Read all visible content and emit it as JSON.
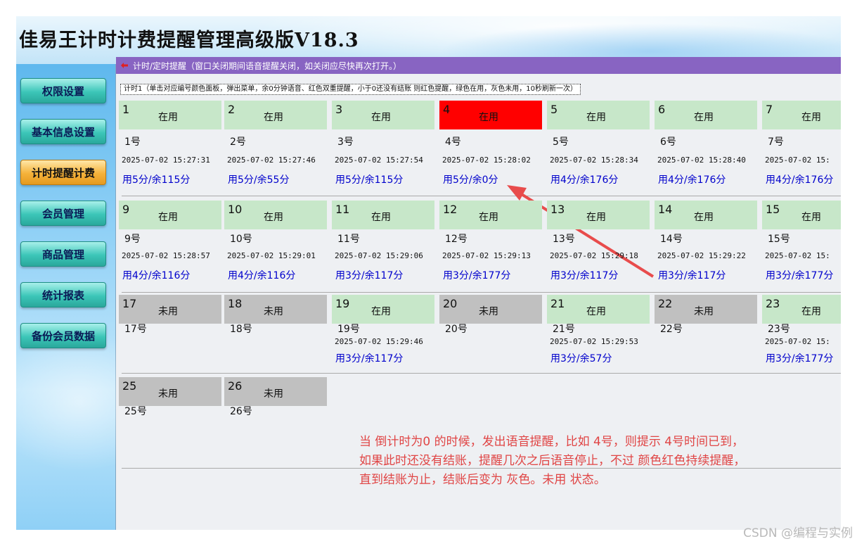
{
  "app": {
    "title": "佳易王计时计费提醒管理高级版V18.3"
  },
  "sidebar": {
    "items": [
      {
        "label": "权限设置",
        "active": false
      },
      {
        "label": "基本信息设置",
        "active": false
      },
      {
        "label": "计时提醒计费",
        "active": true
      },
      {
        "label": "会员管理",
        "active": false
      },
      {
        "label": "商品管理",
        "active": false
      },
      {
        "label": "统计报表",
        "active": false
      },
      {
        "label": "备份会员数据",
        "active": false
      }
    ]
  },
  "main": {
    "window_title": "计时/定时提醒（窗口关闭期间语音提醒关闭，如关闭应尽快再次打开。）",
    "instruction": "计时1（单击对应编号颜色面板，弹出菜单，余0分钟语音、红色双重提醒，小于0还没有结账 则红色提醒，绿色在用，灰色未用，10秒刷新一次）",
    "colors": {
      "in_use": "#c7e7c9",
      "unused": "#c0c0c0",
      "alert": "#ff0000"
    },
    "stations": [
      {
        "num": "1",
        "state": "在用",
        "status": "in_use",
        "name": "1号",
        "time": "2025-07-02 15:27:31",
        "usage": "用5分/余115分"
      },
      {
        "num": "2",
        "state": "在用",
        "status": "in_use",
        "name": "2号",
        "time": "2025-07-02 15:27:46",
        "usage": "用5分/余55分"
      },
      {
        "num": "3",
        "state": "在用",
        "status": "in_use",
        "name": "3号",
        "time": "2025-07-02 15:27:54",
        "usage": "用5分/余115分"
      },
      {
        "num": "4",
        "state": "在用",
        "status": "alert",
        "name": "4号",
        "time": "2025-07-02 15:28:02",
        "usage": "用5分/余0分"
      },
      {
        "num": "5",
        "state": "在用",
        "status": "in_use",
        "name": "5号",
        "time": "2025-07-02 15:28:34",
        "usage": "用4分/余176分"
      },
      {
        "num": "6",
        "state": "在用",
        "status": "in_use",
        "name": "6号",
        "time": "2025-07-02 15:28:40",
        "usage": "用4分/余176分"
      },
      {
        "num": "7",
        "state": "在用",
        "status": "in_use",
        "name": "7号",
        "time": "2025-07-02 15:",
        "usage": "用4分/余176分"
      },
      {
        "num": "9",
        "state": "在用",
        "status": "in_use",
        "name": "9号",
        "time": "2025-07-02 15:28:57",
        "usage": "用4分/余116分"
      },
      {
        "num": "10",
        "state": "在用",
        "status": "in_use",
        "name": "10号",
        "time": "2025-07-02 15:29:01",
        "usage": "用4分/余116分"
      },
      {
        "num": "11",
        "state": "在用",
        "status": "in_use",
        "name": "11号",
        "time": "2025-07-02 15:29:06",
        "usage": "用3分/余117分"
      },
      {
        "num": "12",
        "state": "在用",
        "status": "in_use",
        "name": "12号",
        "time": "2025-07-02 15:29:13",
        "usage": "用3分/余177分"
      },
      {
        "num": "13",
        "state": "在用",
        "status": "in_use",
        "name": "13号",
        "time": "2025-07-02 15:29:18",
        "usage": "用3分/余117分"
      },
      {
        "num": "14",
        "state": "在用",
        "status": "in_use",
        "name": "14号",
        "time": "2025-07-02 15:29:22",
        "usage": "用3分/余117分"
      },
      {
        "num": "15",
        "state": "在用",
        "status": "in_use",
        "name": "15号",
        "time": "2025-07-02 15:",
        "usage": "用3分/余177分"
      },
      {
        "num": "17",
        "state": "未用",
        "status": "unused",
        "name": "17号",
        "time": "",
        "usage": ""
      },
      {
        "num": "18",
        "state": "未用",
        "status": "unused",
        "name": "18号",
        "time": "",
        "usage": ""
      },
      {
        "num": "19",
        "state": "在用",
        "status": "in_use",
        "name": "19号",
        "time": "2025-07-02 15:29:46",
        "usage": "用3分/余117分"
      },
      {
        "num": "20",
        "state": "未用",
        "status": "unused",
        "name": "20号",
        "time": "",
        "usage": ""
      },
      {
        "num": "21",
        "state": "在用",
        "status": "in_use",
        "name": "21号",
        "time": "2025-07-02 15:29:53",
        "usage": "用3分/余57分"
      },
      {
        "num": "22",
        "state": "未用",
        "status": "unused",
        "name": "22号",
        "time": "",
        "usage": ""
      },
      {
        "num": "23",
        "state": "在用",
        "status": "in_use",
        "name": "23号",
        "time": "2025-07-02 15:",
        "usage": "用3分/余177分"
      },
      {
        "num": "25",
        "state": "未用",
        "status": "unused",
        "name": "25号",
        "time": "",
        "usage": ""
      },
      {
        "num": "26",
        "state": "未用",
        "status": "unused",
        "name": "26号",
        "time": "",
        "usage": ""
      }
    ]
  },
  "annotation": {
    "lines": [
      "当 倒计时为0 的时候，发出语音提醒，比如 4号，则提示  4号时间已到，",
      "如果此时还没有结账，提醒几次之后语音停止，不过 颜色红色持续提醒，",
      "直到结账为止，结账后变为 灰色。未用  状态。"
    ],
    "color": "#e04545"
  },
  "watermark": "CSDN @编程与实例"
}
